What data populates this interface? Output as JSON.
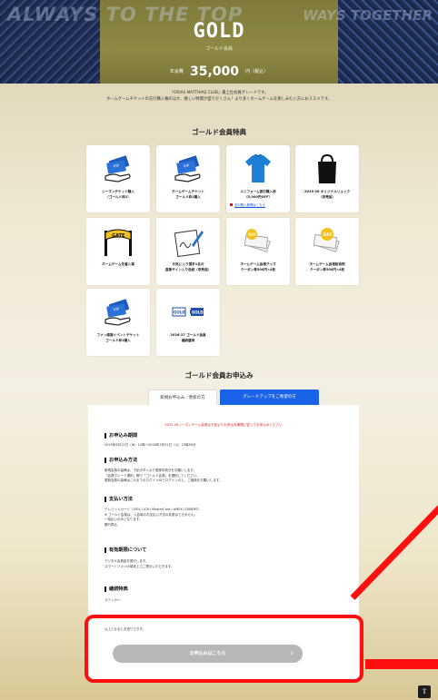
{
  "hero": {
    "slogan_left": "ALWAYS TO THE TOP",
    "slogan_right": "WAYS TOGETHER",
    "title": "GOLD",
    "subtitle": "ゴールド会員",
    "price_label": "年会費",
    "price_amount": "35,000",
    "price_unit": "円（税込）"
  },
  "intro": {
    "line1": "「ORIAS MATTHIAS CLUB」最上位会員グレードです。",
    "line2": "ホームゲームチケットの先行購入権のほか、嬉しい特典が盛りだくさん！より多くホームゲームを楽しみたい方におススメです。"
  },
  "benefits": {
    "title": "ゴールド会員特典",
    "items": [
      {
        "label": "シーズンチケット購入\n（ゴールド枠1）",
        "icon": "ticket-icon"
      },
      {
        "label": "ホームゲームチケット\nゴールド枠1購入",
        "icon": "ticket-icon"
      },
      {
        "label": "ユニフォーム割引購入枠\n（5,000円OFF）",
        "icon": "uniform-icon",
        "link": "割引購入期間はこちら"
      },
      {
        "label": "2025-26 オリジナルリュック\n（非売品）",
        "icon": "backpack-icon"
      },
      {
        "label": "ホームゲーム先着入場",
        "icon": "gate-icon"
      },
      {
        "label": "お気に入り選手1名の\n直筆サイン入り色紙（非売品）",
        "icon": "autograph-icon"
      },
      {
        "label": "ホームゲーム会場グッズ\nクーポン券500円×4枚",
        "icon": "coupon-icon"
      },
      {
        "label": "ホームゲーム会場飲食物\nクーポン券500円×4枚",
        "icon": "coupon-icon"
      },
      {
        "label": "ファン感謝イベントチケット\nゴールド枠1購入",
        "icon": "ticket-icon"
      },
      {
        "label": "2026-27 ゴールド会員\n継続優待",
        "icon": "gold-renewal-icon"
      }
    ]
  },
  "application": {
    "title": "ゴールド会員お申込み",
    "tab_new": "新規お申込み／更新の方",
    "tab_upgrade": "グレードアップをご希望の方",
    "red_note": "2025-26シーズンチーム会員は下記よりお申込み期間に従ってお申込みください",
    "period_heading": "お申込み期間",
    "period_text": "2025年6月12日（木）12時〜2026年3月31日（火）23時59分",
    "method_heading": "お申込み方法",
    "method_text": "新規会員の皆様は、下記ボタンより登録手続きをお願いします。\n「会員グレード選択」欄で「ゴールド会員」を選択してください。\n更新会員の皆様はこれまでのログインIDでログインの上、ご継続をお願いします。",
    "payment_heading": "支払い方法",
    "payment_text": "クレジットカード（VISA / JCB / MasterCard / AMEX / DINERS）\n※ ゴールド会員は、入会時のお支払い方法の変更はできません。\n一括払いのみとなります。\n銀行振込",
    "validity_heading": "有効期限について",
    "validity_text": "デジタル会員証を発行します。\nスマートフォンの端末上でご提示いただきます。",
    "benefit_heading": "継続特典",
    "benefit_text": "ステッカー",
    "bottom_note": "以上となるとお送りできず。",
    "apply_label": "お申込みはこちら"
  }
}
